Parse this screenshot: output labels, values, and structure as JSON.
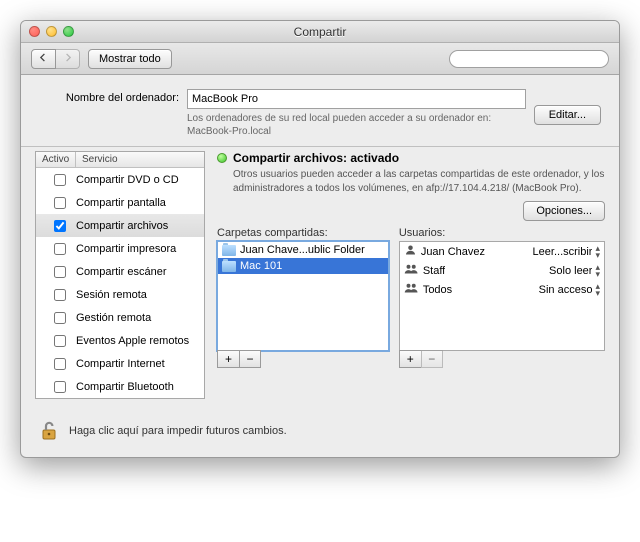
{
  "window_title": "Compartir",
  "toolbar": {
    "show_all": "Mostrar todo",
    "search_placeholder": ""
  },
  "computer_name": {
    "label": "Nombre del ordenador:",
    "value": "MacBook Pro",
    "help1": "Los ordenadores de su red local pueden acceder a su ordenador en:",
    "help2": "MacBook-Pro.local",
    "edit_btn": "Editar..."
  },
  "services": {
    "head_active": "Activo",
    "head_service": "Servicio",
    "items": [
      {
        "label": "Compartir DVD o CD",
        "checked": false
      },
      {
        "label": "Compartir pantalla",
        "checked": false
      },
      {
        "label": "Compartir archivos",
        "checked": true
      },
      {
        "label": "Compartir impresora",
        "checked": false
      },
      {
        "label": "Compartir escáner",
        "checked": false
      },
      {
        "label": "Sesión remota",
        "checked": false
      },
      {
        "label": "Gestión remota",
        "checked": false
      },
      {
        "label": "Eventos Apple remotos",
        "checked": false
      },
      {
        "label": "Compartir Internet",
        "checked": false
      },
      {
        "label": "Compartir Bluetooth",
        "checked": false
      }
    ],
    "selected_index": 2
  },
  "detail": {
    "status_label": "Compartir archivos: activado",
    "description": "Otros usuarios pueden acceder a las carpetas compartidas de este ordenador, y los administradores a todos los volúmenes, en afp://17.104.4.218/ (MacBook Pro).",
    "options_btn": "Opciones...",
    "shared_folders_label": "Carpetas compartidas:",
    "users_label": "Usuarios:",
    "folders": [
      {
        "label": "Juan Chave...ublic Folder",
        "selected": false
      },
      {
        "label": "Mac 101",
        "selected": true
      }
    ],
    "users": [
      {
        "label": "Juan Chavez",
        "type": "user",
        "perm": "Leer...scribir"
      },
      {
        "label": "Staff",
        "type": "group",
        "perm": "Solo leer"
      },
      {
        "label": "Todos",
        "type": "group",
        "perm": "Sin acceso"
      }
    ]
  },
  "lock": {
    "text": "Haga clic aquí para impedir futuros cambios."
  }
}
